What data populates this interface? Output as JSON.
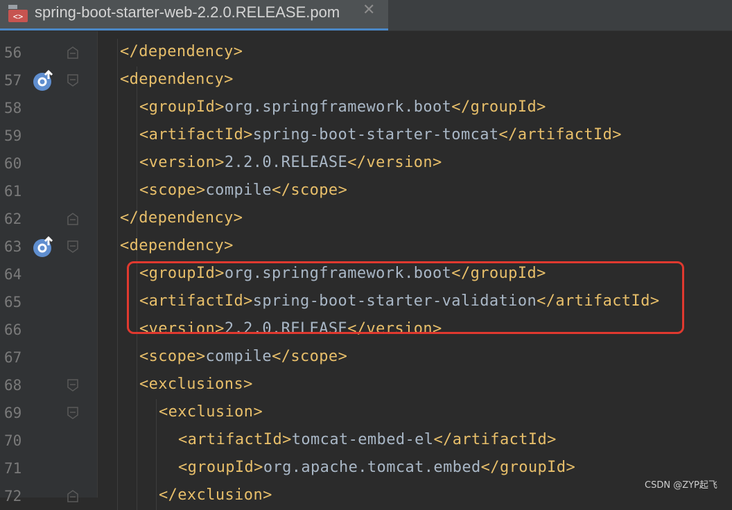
{
  "tab": {
    "title": "spring-boot-starter-web-2.2.0.RELEASE.pom",
    "close_glyph": "✕",
    "icon": "xml-file-icon"
  },
  "colors": {
    "tag": "#e8bf6a",
    "text": "#a9b7c6",
    "highlight": "#e0392f",
    "line_number": "#7a7a7a"
  },
  "lines": [
    {
      "num": "56",
      "indent": 1,
      "gutter_icon": "",
      "fold": "end",
      "segs": [
        {
          "t": "</dependency>",
          "c": "tag"
        }
      ]
    },
    {
      "num": "57",
      "indent": 1,
      "gutter_icon": "override-icon",
      "fold": "start",
      "segs": [
        {
          "t": "<dependency>",
          "c": "tag"
        }
      ]
    },
    {
      "num": "58",
      "indent": 2,
      "gutter_icon": "",
      "fold": "",
      "segs": [
        {
          "t": "<groupId>",
          "c": "tag"
        },
        {
          "t": "org.springframework.boot",
          "c": "txt"
        },
        {
          "t": "</groupId>",
          "c": "tag"
        }
      ]
    },
    {
      "num": "59",
      "indent": 2,
      "gutter_icon": "",
      "fold": "",
      "segs": [
        {
          "t": "<artifactId>",
          "c": "tag"
        },
        {
          "t": "spring-boot-starter-tomcat",
          "c": "txt"
        },
        {
          "t": "</artifactId>",
          "c": "tag"
        }
      ]
    },
    {
      "num": "60",
      "indent": 2,
      "gutter_icon": "",
      "fold": "",
      "segs": [
        {
          "t": "<version>",
          "c": "tag"
        },
        {
          "t": "2.2.0.RELEASE",
          "c": "txt"
        },
        {
          "t": "</version>",
          "c": "tag"
        }
      ]
    },
    {
      "num": "61",
      "indent": 2,
      "gutter_icon": "",
      "fold": "",
      "segs": [
        {
          "t": "<scope>",
          "c": "tag"
        },
        {
          "t": "compile",
          "c": "txt"
        },
        {
          "t": "</scope>",
          "c": "tag"
        }
      ]
    },
    {
      "num": "62",
      "indent": 1,
      "gutter_icon": "",
      "fold": "end",
      "segs": [
        {
          "t": "</dependency>",
          "c": "tag"
        }
      ]
    },
    {
      "num": "63",
      "indent": 1,
      "gutter_icon": "override-icon",
      "fold": "start",
      "segs": [
        {
          "t": "<dependency>",
          "c": "tag"
        }
      ]
    },
    {
      "num": "64",
      "indent": 2,
      "gutter_icon": "",
      "fold": "",
      "segs": [
        {
          "t": "<groupId>",
          "c": "tag"
        },
        {
          "t": "org.springframework.boot",
          "c": "txt"
        },
        {
          "t": "</groupId>",
          "c": "tag"
        }
      ]
    },
    {
      "num": "65",
      "indent": 2,
      "gutter_icon": "",
      "fold": "",
      "segs": [
        {
          "t": "<artifactId>",
          "c": "tag"
        },
        {
          "t": "spring-boot-starter-validation",
          "c": "txt"
        },
        {
          "t": "</artifactId>",
          "c": "tag"
        }
      ]
    },
    {
      "num": "66",
      "indent": 2,
      "gutter_icon": "",
      "fold": "",
      "segs": [
        {
          "t": "<version>",
          "c": "tag"
        },
        {
          "t": "2.2.0.RELEASE",
          "c": "txt"
        },
        {
          "t": "</version>",
          "c": "tag"
        }
      ]
    },
    {
      "num": "67",
      "indent": 2,
      "gutter_icon": "",
      "fold": "",
      "segs": [
        {
          "t": "<scope>",
          "c": "tag"
        },
        {
          "t": "compile",
          "c": "txt"
        },
        {
          "t": "</scope>",
          "c": "tag"
        }
      ]
    },
    {
      "num": "68",
      "indent": 2,
      "gutter_icon": "",
      "fold": "start",
      "segs": [
        {
          "t": "<exclusions>",
          "c": "tag"
        }
      ]
    },
    {
      "num": "69",
      "indent": 3,
      "gutter_icon": "",
      "fold": "start",
      "segs": [
        {
          "t": "<exclusion>",
          "c": "tag"
        }
      ]
    },
    {
      "num": "70",
      "indent": 4,
      "gutter_icon": "",
      "fold": "",
      "segs": [
        {
          "t": "<artifactId>",
          "c": "tag"
        },
        {
          "t": "tomcat-embed-el",
          "c": "txt"
        },
        {
          "t": "</artifactId>",
          "c": "tag"
        }
      ]
    },
    {
      "num": "71",
      "indent": 4,
      "gutter_icon": "",
      "fold": "",
      "segs": [
        {
          "t": "<groupId>",
          "c": "tag"
        },
        {
          "t": "org.apache.tomcat.embed",
          "c": "txt"
        },
        {
          "t": "</groupId>",
          "c": "tag"
        }
      ]
    },
    {
      "num": "72",
      "indent": 3,
      "gutter_icon": "",
      "fold": "end",
      "segs": [
        {
          "t": "</exclusion>",
          "c": "tag"
        }
      ]
    }
  ],
  "watermark": "CSDN @ZYP起飞"
}
